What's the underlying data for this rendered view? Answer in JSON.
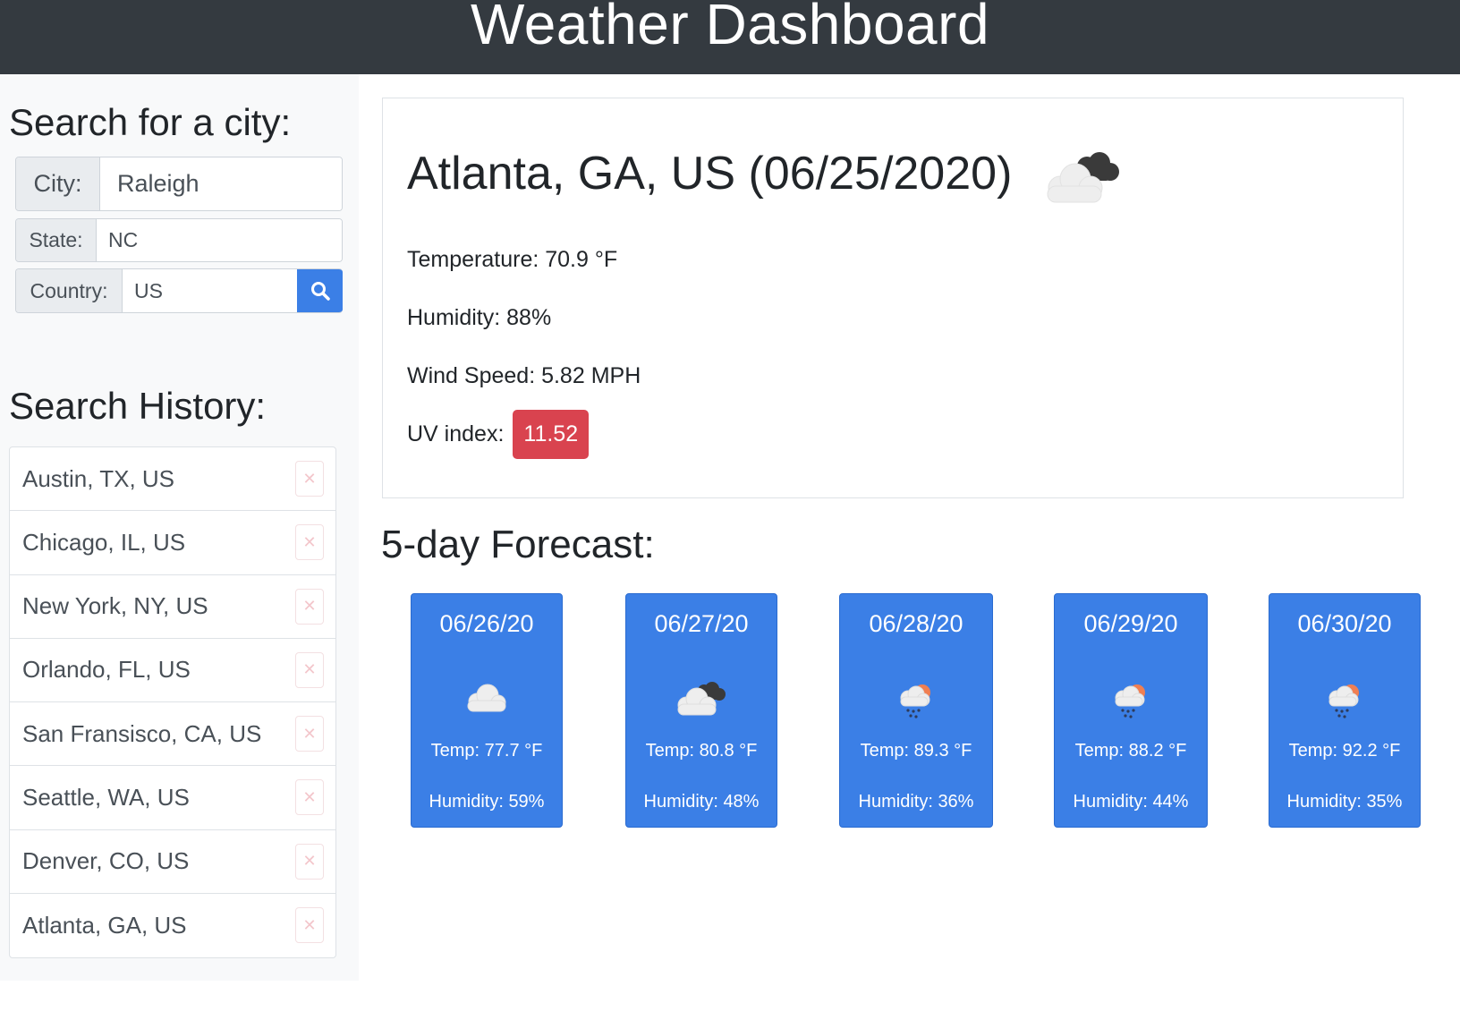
{
  "header": {
    "title": "Weather Dashboard"
  },
  "sidebar": {
    "search_title": "Search for a city:",
    "city": {
      "label": "City:",
      "value": "Raleigh"
    },
    "state": {
      "label": "State:",
      "value": "NC"
    },
    "country": {
      "label": "Country:",
      "value": "US"
    },
    "search_button_icon": "search-icon",
    "history_title": "Search History:",
    "history": [
      {
        "label": "Austin, TX, US",
        "delete_icon": "close-icon"
      },
      {
        "label": "Chicago, IL, US",
        "delete_icon": "close-icon"
      },
      {
        "label": "New York, NY, US",
        "delete_icon": "close-icon"
      },
      {
        "label": "Orlando, FL, US",
        "delete_icon": "close-icon"
      },
      {
        "label": "San Fransisco, CA, US",
        "delete_icon": "close-icon"
      },
      {
        "label": "Seattle, WA, US",
        "delete_icon": "close-icon"
      },
      {
        "label": "Denver, CO, US",
        "delete_icon": "close-icon"
      },
      {
        "label": "Atlanta, GA, US",
        "delete_icon": "close-icon"
      }
    ]
  },
  "current": {
    "title": "Atlanta, GA, US (06/25/2020)",
    "icon": "broken-clouds-icon",
    "temperature": "Temperature: 70.9 °F",
    "humidity": "Humidity: 88%",
    "wind": "Wind Speed: 5.82 MPH",
    "uv_label": "UV index:",
    "uv_value": "11.52"
  },
  "forecast_title": "5-day Forecast:",
  "forecast": [
    {
      "date": "06/26/20",
      "icon": "cloud-icon",
      "temp": "Temp: 77.7 °F",
      "humidity": "Humidity: 59%"
    },
    {
      "date": "06/27/20",
      "icon": "broken-clouds-icon",
      "temp": "Temp: 80.8 °F",
      "humidity": "Humidity: 48%"
    },
    {
      "date": "06/28/20",
      "icon": "sun-rain-icon",
      "temp": "Temp: 89.3 °F",
      "humidity": "Humidity: 36%"
    },
    {
      "date": "06/29/20",
      "icon": "sun-rain-icon",
      "temp": "Temp: 88.2 °F",
      "humidity": "Humidity: 44%"
    },
    {
      "date": "06/30/20",
      "icon": "sun-rain-icon",
      "temp": "Temp: 92.2 °F",
      "humidity": "Humidity: 35%"
    }
  ],
  "colors": {
    "header_bg": "#343a40",
    "primary": "#3b7fe6",
    "uv_danger": "#d9434f",
    "sidebar_bg": "#f8f9fa"
  }
}
